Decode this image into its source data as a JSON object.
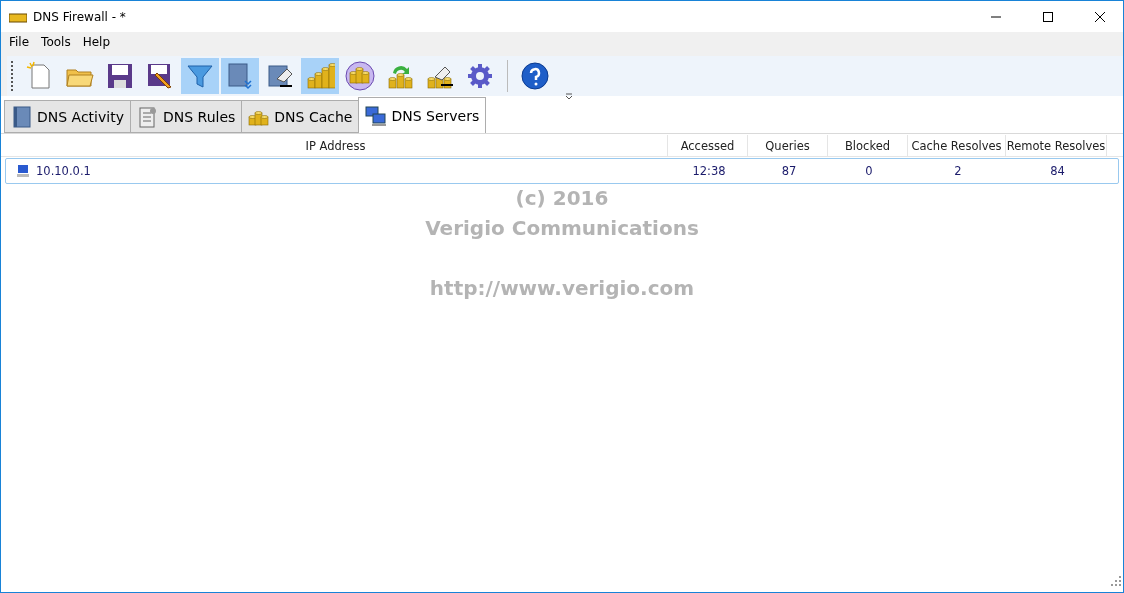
{
  "window": {
    "title": "DNS Firewall - *"
  },
  "menu": [
    "File",
    "Tools",
    "Help"
  ],
  "toolbar": [
    {
      "kind": "new",
      "selected": false
    },
    {
      "kind": "open",
      "selected": false
    },
    {
      "kind": "save",
      "selected": false
    },
    {
      "kind": "saveas",
      "selected": false
    },
    {
      "kind": "filter",
      "selected": true
    },
    {
      "kind": "list",
      "selected": true
    },
    {
      "kind": "erase",
      "selected": false
    },
    {
      "kind": "bars",
      "selected": true
    },
    {
      "kind": "coins",
      "selected": false
    },
    {
      "kind": "refresh",
      "selected": false
    },
    {
      "kind": "clear",
      "selected": false
    },
    {
      "kind": "gear",
      "selected": false
    },
    {
      "kind": "sep"
    },
    {
      "kind": "help",
      "selected": false
    }
  ],
  "tabs": [
    {
      "label": "DNS Activity",
      "kind": "book",
      "selected": false
    },
    {
      "label": "DNS Rules",
      "kind": "rules",
      "selected": false
    },
    {
      "label": "DNS Cache",
      "kind": "coins",
      "selected": false
    },
    {
      "label": "DNS Servers",
      "kind": "servers",
      "selected": true
    }
  ],
  "table": {
    "columns": [
      "IP Address",
      "Accessed",
      "Queries",
      "Blocked",
      "Cache Resolves",
      "Remote Resolves"
    ],
    "rows": [
      {
        "cells": [
          "10.10.0.1",
          "12:38",
          "87",
          "0",
          "2",
          "84"
        ],
        "selected": true
      }
    ]
  },
  "background_text": [
    "(c) 2016",
    "Verigio Communications",
    "http://www.verigio.com"
  ]
}
